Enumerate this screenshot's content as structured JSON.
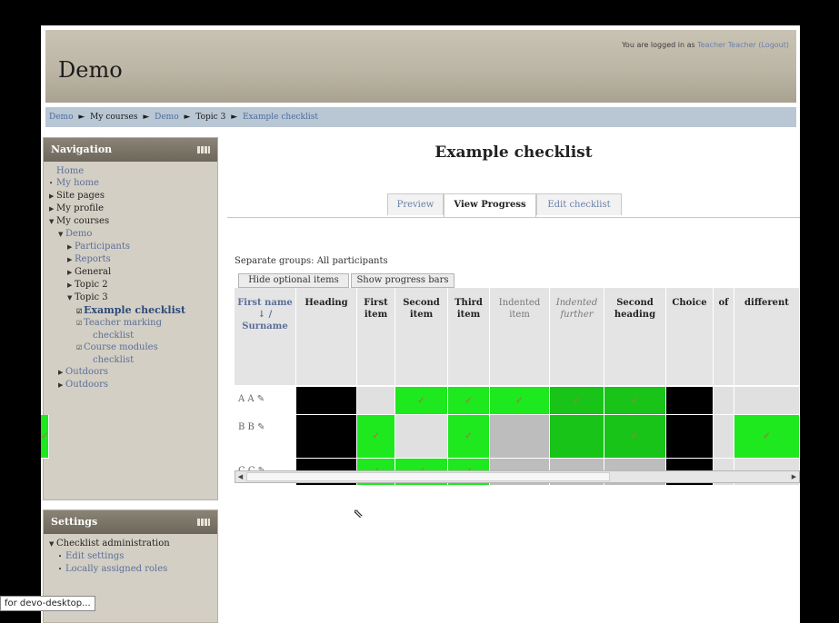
{
  "header": {
    "site_title": "Demo",
    "login_prefix": "You are logged in as",
    "login_user": "Teacher Teacher",
    "logout": "(Logout)"
  },
  "breadcrumb": [
    "Demo",
    "My courses",
    "Demo",
    "Topic 3",
    "Example checklist"
  ],
  "breadcrumb_sep": "►",
  "navigation": {
    "title": "Navigation",
    "items": [
      {
        "label": "Home",
        "indent": 0,
        "marker": "",
        "style": "link"
      },
      {
        "label": "My home",
        "indent": 0,
        "marker": "•",
        "style": "link"
      },
      {
        "label": "Site pages",
        "indent": 0,
        "marker": "▶",
        "style": "plain"
      },
      {
        "label": "My profile",
        "indent": 0,
        "marker": "▶",
        "style": "plain"
      },
      {
        "label": "My courses",
        "indent": 0,
        "marker": "▼",
        "style": "plain"
      },
      {
        "label": "Demo",
        "indent": 1,
        "marker": "▼",
        "style": "link"
      },
      {
        "label": "Participants",
        "indent": 2,
        "marker": "▶",
        "style": "link"
      },
      {
        "label": "Reports",
        "indent": 2,
        "marker": "▶",
        "style": "link"
      },
      {
        "label": "General",
        "indent": 2,
        "marker": "▶",
        "style": "plain"
      },
      {
        "label": "Topic 2",
        "indent": 2,
        "marker": "▶",
        "style": "plain"
      },
      {
        "label": "Topic 3",
        "indent": 2,
        "marker": "▼",
        "style": "plain"
      },
      {
        "label": "Example checklist",
        "indent": 3,
        "marker": "☑",
        "style": "active"
      },
      {
        "label": "Teacher marking",
        "indent": 3,
        "marker": "☑",
        "style": "link"
      },
      {
        "label": "checklist",
        "indent": 4,
        "marker": "",
        "style": "link"
      },
      {
        "label": "Course modules",
        "indent": 3,
        "marker": "☑",
        "style": "link"
      },
      {
        "label": "checklist",
        "indent": 4,
        "marker": "",
        "style": "link"
      },
      {
        "label": "Outdoors",
        "indent": 1,
        "marker": "▶",
        "style": "link"
      },
      {
        "label": "Outdoors",
        "indent": 1,
        "marker": "▶",
        "style": "link"
      }
    ]
  },
  "settings": {
    "title": "Settings",
    "items": [
      {
        "label": "Checklist administration",
        "indent": 0,
        "marker": "▼",
        "style": "plain"
      },
      {
        "label": "Edit settings",
        "indent": 1,
        "marker": "•",
        "style": "link"
      },
      {
        "label": "Locally assigned roles",
        "indent": 1,
        "marker": "•",
        "style": "link"
      }
    ]
  },
  "content": {
    "title": "Example checklist",
    "tabs": [
      "Preview",
      "View Progress",
      "Edit checklist"
    ],
    "selected_tab": 1,
    "groups_label": "Separate groups: All participants",
    "hide_optional": "Hide optional items",
    "show_progress": "Show progress bars"
  },
  "table": {
    "columns": [
      {
        "label": "First name ↓ / Surname",
        "style": "link"
      },
      {
        "label": "Heading",
        "style": "bold"
      },
      {
        "label": "First item",
        "style": "bold"
      },
      {
        "label": "Second item",
        "style": "bold"
      },
      {
        "label": "Third item",
        "style": "bold"
      },
      {
        "label": "Indented item",
        "style": "light"
      },
      {
        "label": "Indented further",
        "style": "italic"
      },
      {
        "label": "Second heading",
        "style": "bold"
      },
      {
        "label": "Choice",
        "style": "bold"
      },
      {
        "label": "of",
        "style": "bold"
      },
      {
        "label": "different",
        "style": "bold"
      }
    ],
    "rows": [
      {
        "name": "A A",
        "cells": [
          "black",
          "light",
          "green",
          "green",
          "green",
          "dgreen",
          "dgreen",
          "black",
          "light",
          "light",
          "light"
        ],
        "checks": [
          false,
          false,
          true,
          true,
          true,
          true,
          true,
          false,
          false,
          false,
          false
        ]
      },
      {
        "name": "B B",
        "cells": [
          "black",
          "green",
          "light",
          "green",
          "gray",
          "dgreen",
          "dgreen",
          "black",
          "light",
          "green",
          "green"
        ],
        "checks": [
          false,
          true,
          false,
          true,
          false,
          false,
          true,
          false,
          false,
          true,
          true
        ]
      },
      {
        "name": "C C",
        "cells": [
          "black",
          "green",
          "green",
          "green",
          "gray",
          "gray",
          "gray",
          "black",
          "light",
          "light",
          "light"
        ],
        "checks": [
          false,
          true,
          true,
          true,
          false,
          false,
          false,
          false,
          false,
          false,
          false
        ]
      }
    ],
    "check_glyph": "✓"
  },
  "status_text": "for devo-desktop...",
  "icons": {
    "edit": "pencil-icon",
    "sort": "sort-down-icon",
    "cursor": "mouse-pointer-icon"
  }
}
